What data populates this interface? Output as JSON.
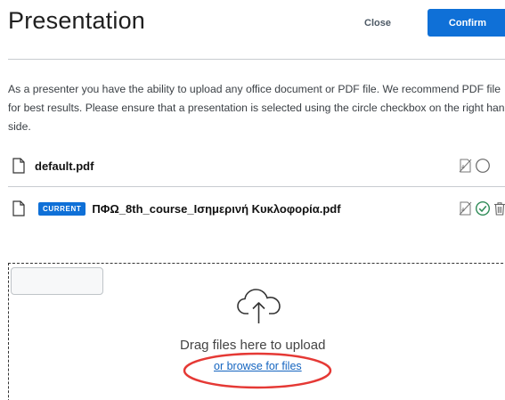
{
  "header": {
    "title": "Presentation",
    "close_label": "Close",
    "confirm_label": "Confirm"
  },
  "description": "As a presenter you have the ability to upload any office document or PDF file. We recommend PDF file for best results. Please ensure that a presentation is selected using the circle checkbox on the right hand side.",
  "files": [
    {
      "name": "default.pdf",
      "current": false,
      "selected": false,
      "removable": false
    },
    {
      "name": "ΠΦΩ_8th_course_Ισημερινή Κυκλοφορία.pdf",
      "current": true,
      "badge_label": "CURRENT",
      "selected": true,
      "removable": true
    }
  ],
  "dropzone": {
    "drag_text": "Drag files here to upload",
    "browse_text": "or browse for files"
  },
  "colors": {
    "primary": "#0f70d7",
    "selected_check": "#2e8b57",
    "highlight": "#e53935"
  },
  "icons": {
    "file": "file-icon",
    "download_toggle": "download-disabled-icon",
    "select": "select-circle-icon",
    "check": "check-circle-icon",
    "trash": "trash-icon",
    "upload": "cloud-upload-icon"
  }
}
